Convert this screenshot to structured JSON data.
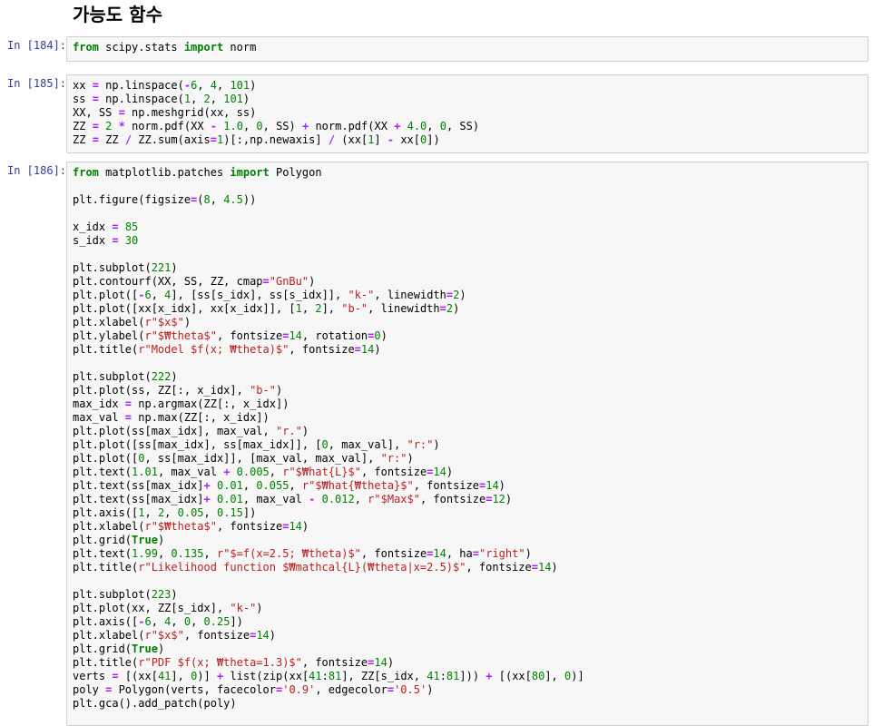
{
  "heading": "가능도 함수",
  "cells": [
    {
      "prompt": "In [184]:",
      "lines": [
        [
          [
            "kw",
            "from"
          ],
          [
            "t",
            " scipy.stats "
          ],
          [
            "kw",
            "import"
          ],
          [
            "t",
            " norm"
          ]
        ]
      ]
    },
    {
      "prompt": "In [185]:",
      "lines": [
        [
          [
            "t",
            "xx "
          ],
          [
            "op",
            "="
          ],
          [
            "t",
            " np.linspace("
          ],
          [
            "op",
            "-"
          ],
          [
            "num",
            "6"
          ],
          [
            "t",
            ", "
          ],
          [
            "num",
            "4"
          ],
          [
            "t",
            ", "
          ],
          [
            "num",
            "101"
          ],
          [
            "t",
            ")"
          ]
        ],
        [
          [
            "t",
            "ss "
          ],
          [
            "op",
            "="
          ],
          [
            "t",
            " np.linspace("
          ],
          [
            "num",
            "1"
          ],
          [
            "t",
            ", "
          ],
          [
            "num",
            "2"
          ],
          [
            "t",
            ", "
          ],
          [
            "num",
            "101"
          ],
          [
            "t",
            ")"
          ]
        ],
        [
          [
            "t",
            "XX, SS "
          ],
          [
            "op",
            "="
          ],
          [
            "t",
            " np.meshgrid(xx, ss)"
          ]
        ],
        [
          [
            "t",
            "ZZ "
          ],
          [
            "op",
            "="
          ],
          [
            "t",
            " "
          ],
          [
            "num",
            "2"
          ],
          [
            "t",
            " "
          ],
          [
            "op",
            "*"
          ],
          [
            "t",
            " norm.pdf(XX "
          ],
          [
            "op",
            "-"
          ],
          [
            "t",
            " "
          ],
          [
            "num",
            "1.0"
          ],
          [
            "t",
            ", "
          ],
          [
            "num",
            "0"
          ],
          [
            "t",
            ", SS) "
          ],
          [
            "op",
            "+"
          ],
          [
            "t",
            " norm.pdf(XX "
          ],
          [
            "op",
            "+"
          ],
          [
            "t",
            " "
          ],
          [
            "num",
            "4.0"
          ],
          [
            "t",
            ", "
          ],
          [
            "num",
            "0"
          ],
          [
            "t",
            ", SS)"
          ]
        ],
        [
          [
            "t",
            "ZZ "
          ],
          [
            "op",
            "="
          ],
          [
            "t",
            " ZZ "
          ],
          [
            "op",
            "/"
          ],
          [
            "t",
            " ZZ.sum(axis"
          ],
          [
            "op",
            "="
          ],
          [
            "num",
            "1"
          ],
          [
            "t",
            ")[:,np.newaxis] "
          ],
          [
            "op",
            "/"
          ],
          [
            "t",
            " (xx["
          ],
          [
            "num",
            "1"
          ],
          [
            "t",
            "] "
          ],
          [
            "op",
            "-"
          ],
          [
            "t",
            " xx["
          ],
          [
            "num",
            "0"
          ],
          [
            "t",
            "])"
          ]
        ]
      ]
    },
    {
      "prompt": "In [186]:",
      "lines": [
        [
          [
            "kw",
            "from"
          ],
          [
            "t",
            " matplotlib.patches "
          ],
          [
            "kw",
            "import"
          ],
          [
            "t",
            " Polygon"
          ]
        ],
        [],
        [
          [
            "t",
            "plt.figure(figsize"
          ],
          [
            "op",
            "="
          ],
          [
            "t",
            "("
          ],
          [
            "num",
            "8"
          ],
          [
            "t",
            ", "
          ],
          [
            "num",
            "4.5"
          ],
          [
            "t",
            "))"
          ]
        ],
        [],
        [
          [
            "t",
            "x_idx "
          ],
          [
            "op",
            "="
          ],
          [
            "t",
            " "
          ],
          [
            "num",
            "85"
          ]
        ],
        [
          [
            "t",
            "s_idx "
          ],
          [
            "op",
            "="
          ],
          [
            "t",
            " "
          ],
          [
            "num",
            "30"
          ]
        ],
        [],
        [
          [
            "t",
            "plt.subplot("
          ],
          [
            "num",
            "221"
          ],
          [
            "t",
            ")"
          ]
        ],
        [
          [
            "t",
            "plt.contourf(XX, SS, ZZ, cmap"
          ],
          [
            "op",
            "="
          ],
          [
            "str",
            "\"GnBu\""
          ],
          [
            "t",
            ")"
          ]
        ],
        [
          [
            "t",
            "plt.plot(["
          ],
          [
            "op",
            "-"
          ],
          [
            "num",
            "6"
          ],
          [
            "t",
            ", "
          ],
          [
            "num",
            "4"
          ],
          [
            "t",
            "], [ss[s_idx], ss[s_idx]], "
          ],
          [
            "str",
            "\"k-\""
          ],
          [
            "t",
            ", linewidth"
          ],
          [
            "op",
            "="
          ],
          [
            "num",
            "2"
          ],
          [
            "t",
            ")"
          ]
        ],
        [
          [
            "t",
            "plt.plot([xx[x_idx], xx[x_idx]], ["
          ],
          [
            "num",
            "1"
          ],
          [
            "t",
            ", "
          ],
          [
            "num",
            "2"
          ],
          [
            "t",
            "], "
          ],
          [
            "str",
            "\"b-\""
          ],
          [
            "t",
            ", linewidth"
          ],
          [
            "op",
            "="
          ],
          [
            "num",
            "2"
          ],
          [
            "t",
            ")"
          ]
        ],
        [
          [
            "t",
            "plt.xlabel("
          ],
          [
            "str",
            "r\"$x$\""
          ],
          [
            "t",
            ")"
          ]
        ],
        [
          [
            "t",
            "plt.ylabel("
          ],
          [
            "str",
            "r\"$₩theta$\""
          ],
          [
            "t",
            ", fontsize"
          ],
          [
            "op",
            "="
          ],
          [
            "num",
            "14"
          ],
          [
            "t",
            ", rotation"
          ],
          [
            "op",
            "="
          ],
          [
            "num",
            "0"
          ],
          [
            "t",
            ")"
          ]
        ],
        [
          [
            "t",
            "plt.title("
          ],
          [
            "str",
            "r\"Model $f(x; ₩theta)$\""
          ],
          [
            "t",
            ", fontsize"
          ],
          [
            "op",
            "="
          ],
          [
            "num",
            "14"
          ],
          [
            "t",
            ")"
          ]
        ],
        [],
        [
          [
            "t",
            "plt.subplot("
          ],
          [
            "num",
            "222"
          ],
          [
            "t",
            ")"
          ]
        ],
        [
          [
            "t",
            "plt.plot(ss, ZZ[:, x_idx], "
          ],
          [
            "str",
            "\"b-\""
          ],
          [
            "t",
            ")"
          ]
        ],
        [
          [
            "t",
            "max_idx "
          ],
          [
            "op",
            "="
          ],
          [
            "t",
            " np.argmax(ZZ[:, x_idx])"
          ]
        ],
        [
          [
            "t",
            "max_val "
          ],
          [
            "op",
            "="
          ],
          [
            "t",
            " np.max(ZZ[:, x_idx])"
          ]
        ],
        [
          [
            "t",
            "plt.plot(ss[max_idx], max_val, "
          ],
          [
            "str",
            "\"r.\""
          ],
          [
            "t",
            ")"
          ]
        ],
        [
          [
            "t",
            "plt.plot([ss[max_idx], ss[max_idx]], ["
          ],
          [
            "num",
            "0"
          ],
          [
            "t",
            ", max_val], "
          ],
          [
            "str",
            "\"r:\""
          ],
          [
            "t",
            ")"
          ]
        ],
        [
          [
            "t",
            "plt.plot(["
          ],
          [
            "num",
            "0"
          ],
          [
            "t",
            ", ss[max_idx]], [max_val, max_val], "
          ],
          [
            "str",
            "\"r:\""
          ],
          [
            "t",
            ")"
          ]
        ],
        [
          [
            "t",
            "plt.text("
          ],
          [
            "num",
            "1.01"
          ],
          [
            "t",
            ", max_val "
          ],
          [
            "op",
            "+"
          ],
          [
            "t",
            " "
          ],
          [
            "num",
            "0.005"
          ],
          [
            "t",
            ", "
          ],
          [
            "str",
            "r\"$₩hat{L}$\""
          ],
          [
            "t",
            ", fontsize"
          ],
          [
            "op",
            "="
          ],
          [
            "num",
            "14"
          ],
          [
            "t",
            ")"
          ]
        ],
        [
          [
            "t",
            "plt.text(ss[max_idx]"
          ],
          [
            "op",
            "+"
          ],
          [
            "t",
            " "
          ],
          [
            "num",
            "0.01"
          ],
          [
            "t",
            ", "
          ],
          [
            "num",
            "0.055"
          ],
          [
            "t",
            ", "
          ],
          [
            "str",
            "r\"$₩hat{₩theta}$\""
          ],
          [
            "t",
            ", fontsize"
          ],
          [
            "op",
            "="
          ],
          [
            "num",
            "14"
          ],
          [
            "t",
            ")"
          ]
        ],
        [
          [
            "t",
            "plt.text(ss[max_idx]"
          ],
          [
            "op",
            "+"
          ],
          [
            "t",
            " "
          ],
          [
            "num",
            "0.01"
          ],
          [
            "t",
            ", max_val "
          ],
          [
            "op",
            "-"
          ],
          [
            "t",
            " "
          ],
          [
            "num",
            "0.012"
          ],
          [
            "t",
            ", "
          ],
          [
            "str",
            "r\"$Max$\""
          ],
          [
            "t",
            ", fontsize"
          ],
          [
            "op",
            "="
          ],
          [
            "num",
            "12"
          ],
          [
            "t",
            ")"
          ]
        ],
        [
          [
            "t",
            "plt.axis(["
          ],
          [
            "num",
            "1"
          ],
          [
            "t",
            ", "
          ],
          [
            "num",
            "2"
          ],
          [
            "t",
            ", "
          ],
          [
            "num",
            "0.05"
          ],
          [
            "t",
            ", "
          ],
          [
            "num",
            "0.15"
          ],
          [
            "t",
            "])"
          ]
        ],
        [
          [
            "t",
            "plt.xlabel("
          ],
          [
            "str",
            "r\"$₩theta$\""
          ],
          [
            "t",
            ", fontsize"
          ],
          [
            "op",
            "="
          ],
          [
            "num",
            "14"
          ],
          [
            "t",
            ")"
          ]
        ],
        [
          [
            "t",
            "plt.grid("
          ],
          [
            "kw",
            "True"
          ],
          [
            "t",
            ")"
          ]
        ],
        [
          [
            "t",
            "plt.text("
          ],
          [
            "num",
            "1.99"
          ],
          [
            "t",
            ", "
          ],
          [
            "num",
            "0.135"
          ],
          [
            "t",
            ", "
          ],
          [
            "str",
            "r\"$=f(x=2.5; ₩theta)$\""
          ],
          [
            "t",
            ", fontsize"
          ],
          [
            "op",
            "="
          ],
          [
            "num",
            "14"
          ],
          [
            "t",
            ", ha"
          ],
          [
            "op",
            "="
          ],
          [
            "str",
            "\"right\""
          ],
          [
            "t",
            ")"
          ]
        ],
        [
          [
            "t",
            "plt.title("
          ],
          [
            "str",
            "r\"Likelihood function $₩mathcal{L}(₩theta|x=2.5)$\""
          ],
          [
            "t",
            ", fontsize"
          ],
          [
            "op",
            "="
          ],
          [
            "num",
            "14"
          ],
          [
            "t",
            ")"
          ]
        ],
        [],
        [
          [
            "t",
            "plt.subplot("
          ],
          [
            "num",
            "223"
          ],
          [
            "t",
            ")"
          ]
        ],
        [
          [
            "t",
            "plt.plot(xx, ZZ[s_idx], "
          ],
          [
            "str",
            "\"k-\""
          ],
          [
            "t",
            ")"
          ]
        ],
        [
          [
            "t",
            "plt.axis(["
          ],
          [
            "op",
            "-"
          ],
          [
            "num",
            "6"
          ],
          [
            "t",
            ", "
          ],
          [
            "num",
            "4"
          ],
          [
            "t",
            ", "
          ],
          [
            "num",
            "0"
          ],
          [
            "t",
            ", "
          ],
          [
            "num",
            "0.25"
          ],
          [
            "t",
            "])"
          ]
        ],
        [
          [
            "t",
            "plt.xlabel("
          ],
          [
            "str",
            "r\"$x$\""
          ],
          [
            "t",
            ", fontsize"
          ],
          [
            "op",
            "="
          ],
          [
            "num",
            "14"
          ],
          [
            "t",
            ")"
          ]
        ],
        [
          [
            "t",
            "plt.grid("
          ],
          [
            "kw",
            "True"
          ],
          [
            "t",
            ")"
          ]
        ],
        [
          [
            "t",
            "plt.title("
          ],
          [
            "str",
            "r\"PDF $f(x; ₩theta=1.3)$\""
          ],
          [
            "t",
            ", fontsize"
          ],
          [
            "op",
            "="
          ],
          [
            "num",
            "14"
          ],
          [
            "t",
            ")"
          ]
        ],
        [
          [
            "t",
            "verts "
          ],
          [
            "op",
            "="
          ],
          [
            "t",
            " [(xx["
          ],
          [
            "num",
            "41"
          ],
          [
            "t",
            "], "
          ],
          [
            "num",
            "0"
          ],
          [
            "t",
            ")] "
          ],
          [
            "op",
            "+"
          ],
          [
            "t",
            " list(zip(xx["
          ],
          [
            "num",
            "41"
          ],
          [
            "t",
            ":"
          ],
          [
            "num",
            "81"
          ],
          [
            "t",
            "], ZZ[s_idx, "
          ],
          [
            "num",
            "41"
          ],
          [
            "t",
            ":"
          ],
          [
            "num",
            "81"
          ],
          [
            "t",
            "])) "
          ],
          [
            "op",
            "+"
          ],
          [
            "t",
            " [(xx["
          ],
          [
            "num",
            "80"
          ],
          [
            "t",
            "], "
          ],
          [
            "num",
            "0"
          ],
          [
            "t",
            ")]"
          ]
        ],
        [
          [
            "t",
            "poly "
          ],
          [
            "op",
            "="
          ],
          [
            "t",
            " Polygon(verts, facecolor"
          ],
          [
            "op",
            "="
          ],
          [
            "str",
            "'0.9'"
          ],
          [
            "t",
            ", edgecolor"
          ],
          [
            "op",
            "="
          ],
          [
            "str",
            "'0.5'"
          ],
          [
            "t",
            ")"
          ]
        ],
        [
          [
            "t",
            "plt.gca().add_patch(poly)"
          ]
        ]
      ]
    }
  ]
}
